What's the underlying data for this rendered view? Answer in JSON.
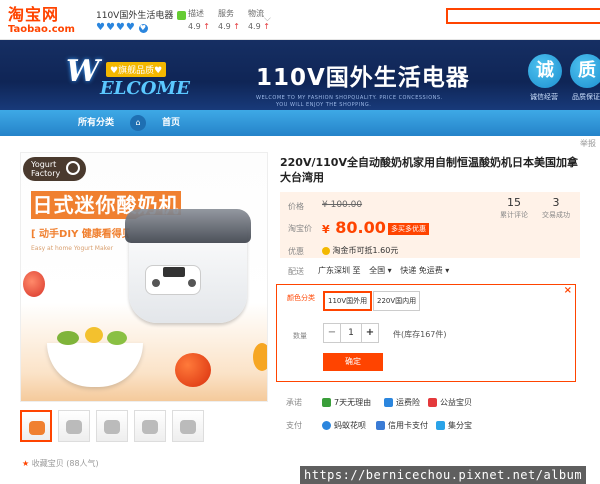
{
  "logo": {
    "cn": "淘宝网",
    "en": "Taobao.com"
  },
  "shop": {
    "name": "110V国外生活电器",
    "hearts": "♥♥♥♥",
    "tmall_badge": "♥"
  },
  "scores": [
    {
      "label": "描述",
      "value": "4.9",
      "arrow": "↑"
    },
    {
      "label": "服务",
      "value": "4.9",
      "arrow": "↑"
    },
    {
      "label": "物流",
      "value": "4.9",
      "arrow": "↑"
    }
  ],
  "banner": {
    "welcome_w": "W",
    "welcome_rest": "ELCOME",
    "flag": "♥旗舰品质♥",
    "title": "110V国外生活电器",
    "tagline_1": "WELCOME TO MY FASHION SHOPQUALITY. PRICE CONCESSIONS.",
    "tagline_2": "YOU WILL ENJOY THE SHOPPING.",
    "badges": [
      {
        "char": "诚",
        "caption": "诚信经营"
      },
      {
        "char": "质",
        "caption": "品质保证"
      }
    ]
  },
  "nav": {
    "all": "所有分类",
    "home": "首页"
  },
  "tools": "举报",
  "product_image": {
    "badge_line1": "Yogurt",
    "badge_line2": "Factory",
    "headline": "日式迷你酸奶机",
    "sub1": "[ 动手DIY  健康看得见 ]",
    "sub2": "Easy at home Yogurt Maker"
  },
  "favorites": {
    "star": "★",
    "text": "收藏宝贝 (88人气)"
  },
  "product": {
    "title": "220V/110V全自动酸奶机家用自制恒温酸奶机日本美国加拿大台湾用",
    "price_label": "价格",
    "old_price": "¥ 100.00",
    "taobao_price_label": "淘宝价",
    "new_price_symbol": "¥",
    "new_price": "80.00",
    "promo": "多买多优惠",
    "reviews_count": "15",
    "reviews_label": "累计评论",
    "sales_count": "3",
    "sales_label": "交易成功",
    "discount_label": "优惠",
    "coupon": "淘金币可抵1.60元",
    "ship_label": "配送",
    "ship_from": "广东深圳 至",
    "ship_to": "全国 ▾",
    "ship_type": "快递 免运费 ▾"
  },
  "sku": {
    "color_label": "颜色分类",
    "options": [
      "110V国外用",
      "220V国内用"
    ],
    "close": "×",
    "qty_label": "数量",
    "minus": "−",
    "qty": "1",
    "plus": "+",
    "stock": "件(库存167件)",
    "confirm": "确定"
  },
  "services": {
    "promise_label": "承诺",
    "promises": [
      "7天无理由",
      "运费险",
      "公益宝贝"
    ],
    "pay_label": "支付",
    "payments": [
      "蚂蚁花呗",
      "信用卡支付",
      "集分宝"
    ]
  },
  "watermark": "https://bernicechou.pixnet.net/album",
  "colors": {
    "accent": "#ff4400",
    "nav": "#2b86de",
    "banner": "#162f63"
  }
}
